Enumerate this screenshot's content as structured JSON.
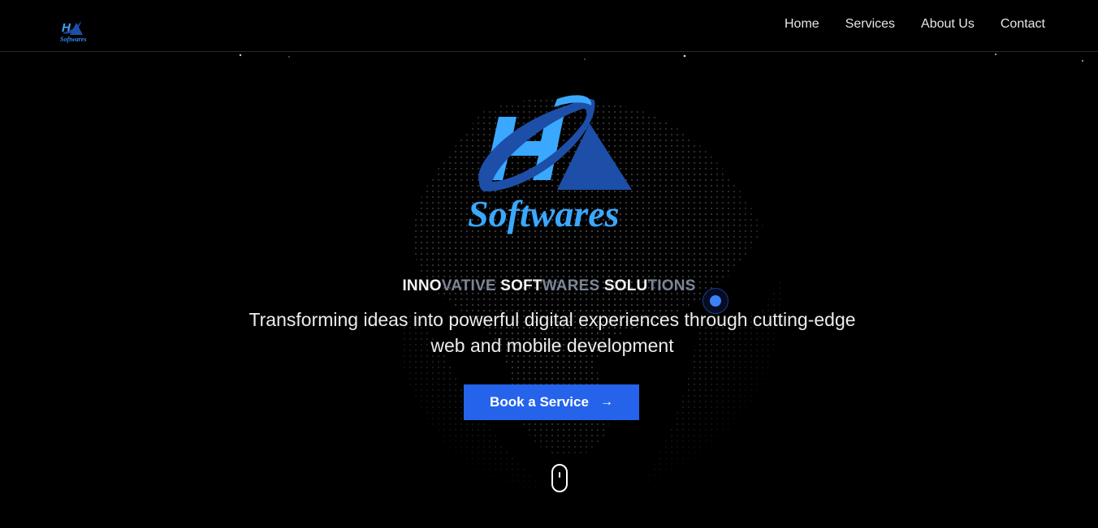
{
  "header": {
    "logo_word": "Softwares",
    "nav": {
      "home": "Home",
      "services": "Services",
      "about": "About Us",
      "contact": "Contact"
    }
  },
  "hero": {
    "logo_word": "Softwares",
    "tagline": {
      "w1": "INNO",
      "d1": "VATIVE",
      "w2": "SOFT",
      "d2": "WARES",
      "w3": "SOLU",
      "d3": "TIONS"
    },
    "subtitle": "Transforming ideas into powerful digital experiences through cutting-edge web and mobile development",
    "cta_label": "Book a Service",
    "cta_icon": "arrow-right-icon",
    "scroll_icon": "mouse-scroll-icon"
  },
  "colors": {
    "background": "#000000",
    "accent": "#2563eb",
    "logo_light": "#3aa8ff",
    "logo_dark": "#1d4fa8",
    "tagline_dim": "#7b8596"
  }
}
